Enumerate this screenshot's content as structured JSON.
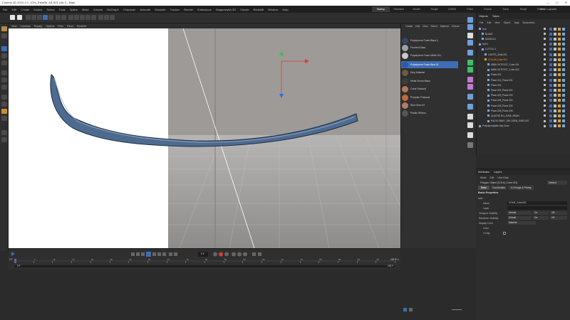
{
  "titlebar": {
    "title": "Cinema 4D 2023.1.0 - [Ohl_Estrella_48_001.c4d *] - Main",
    "minimize": "—",
    "maximize": "☐",
    "close": "✕"
  },
  "menu": [
    "File",
    "Edit",
    "Create",
    "Modes",
    "Select",
    "Tools",
    "Spline",
    "Mesh",
    "Volume",
    "MoGraph",
    "Character",
    "Animate",
    "Simulate",
    "Tracker",
    "Render",
    "Extensions",
    "Diagnostyka 3D",
    "Crisole",
    "Redshift",
    "Window",
    "Help"
  ],
  "layouts": [
    "Startup",
    "Standard",
    "Model",
    "Sculpt",
    "UVEdit",
    "Paint",
    "Groom",
    "Track",
    "Script",
    "Nodes"
  ],
  "new_layouts": "New Layouts",
  "viewport_menu": [
    "View",
    "Cameras",
    "Display",
    "Options",
    "Filter",
    "Panel",
    "Redshift"
  ],
  "materials_menu": [
    "Create",
    "Edit",
    "View",
    "Select",
    "Material",
    "Texture"
  ],
  "materials": [
    {
      "name": "Polystyrene Foam Black 1",
      "color": "#3a4566",
      "selected": false
    },
    {
      "name": "Frosted Glass",
      "color": "#9aa3a8",
      "selected": false
    },
    {
      "name": "Polystyrene Foam White 011",
      "color": "#c9c9c9",
      "selected": false
    },
    {
      "name": "Polystyrene Foam Blue 01",
      "color": "#2d5aa8",
      "selected": true
    },
    {
      "name": "Dirty Material",
      "color": "#6e5a48",
      "selected": false
    },
    {
      "name": "Metal Screw Black",
      "color": "#3c3c3c",
      "selected": false
    },
    {
      "name": "Coral Flatcoral",
      "color": "#b07a5a",
      "selected": false
    },
    {
      "name": "Pumpkin Flatcoral",
      "color": "#c0693a",
      "selected": false
    },
    {
      "name": "Skin Glow 03",
      "color": "#b57a66",
      "selected": false
    },
    {
      "name": "Plastic Ribbon",
      "color": "#555555",
      "selected": false
    }
  ],
  "objects_tabs": [
    "Objects",
    "Takes"
  ],
  "objects_menu": [
    "File",
    "Edit",
    "View",
    "Object",
    "Tags",
    "Bookmarks"
  ],
  "objects": [
    {
      "name": "Sun",
      "sel": false
    },
    {
      "name": "BLADE",
      "sel": false
    },
    {
      "name": "MODEL01",
      "sel": false
    },
    {
      "name": "Null.1",
      "sel": false
    },
    {
      "name": "CUTTLE.2",
      "sel": false
    },
    {
      "name": "LIGHTS_Zsfrk.001",
      "sel": false
    },
    {
      "name": "COLUM_Cube.001",
      "sel": true
    },
    {
      "name": "UBBLOUTFOOT_Cube.001",
      "sel": false
    },
    {
      "name": "UBBLOUTFOOT_Cube.002",
      "sel": false
    },
    {
      "name": "Plane.001",
      "sel": false
    },
    {
      "name": "Plane.001_Plane.001",
      "sel": false
    },
    {
      "name": "Plane.002",
      "sel": false
    },
    {
      "name": "Plane.002_Plane.002",
      "sel": false
    },
    {
      "name": "Plane.003_Plane.003",
      "sel": false
    },
    {
      "name": "Plane.004_Plane.004",
      "sel": false
    },
    {
      "name": "Plane.005_Plane.005",
      "sel": false
    },
    {
      "name": "Plane.006_Plane.006",
      "sel": false
    },
    {
      "name": "QUATRE.RO_JUNK_BEAM",
      "sel": false
    },
    {
      "name": "RADIX.SMKE_JNK.DEEB_EARS.001",
      "sel": false
    },
    {
      "name": "Polystyrenplatte Hep Zone",
      "sel": false
    }
  ],
  "attributes_tabs": [
    "Attributes",
    "Layers"
  ],
  "attributes_menu": [
    "Mode",
    "Edit",
    "User Data"
  ],
  "attr_object_label": "Polygon Object [COLM_Cube.001]",
  "attr_default": "Default",
  "attr_tabs": [
    "Basic",
    "Coordinates",
    "U-Grouge & Phong"
  ],
  "basic_properties": "Basic Properties",
  "icon_section": "Icon",
  "fields": [
    {
      "label": "Name",
      "value": "COLM_Cube.001"
    },
    {
      "label": "Layer",
      "value": ""
    },
    {
      "label": "Viewport Visibility",
      "value": "Default",
      "value2": "On",
      "value3": "Off"
    },
    {
      "label": "Renderer Visibility",
      "value": "Default",
      "value2": "On",
      "value3": "Off"
    },
    {
      "label": "Display Color",
      "value": "Material"
    },
    {
      "label": "Color",
      "value": ""
    },
    {
      "label": "X-Ray",
      "value": ""
    }
  ],
  "timeline": {
    "frame_start": "0 F",
    "frame_end": "100 F",
    "current": "0 F",
    "range_start": "0 F",
    "range_end": "100 F",
    "ticks": [
      "0",
      "5",
      "10",
      "15",
      "20",
      "25",
      "30",
      "35",
      "40",
      "45",
      "50",
      "55",
      "60",
      "65",
      "70",
      "75",
      "80",
      "85",
      "90",
      "95",
      "100"
    ]
  },
  "colors": {
    "accent": "#3d6db5",
    "selected_object": "#ff9b1f",
    "viewport_bg": "#9d9a98"
  }
}
